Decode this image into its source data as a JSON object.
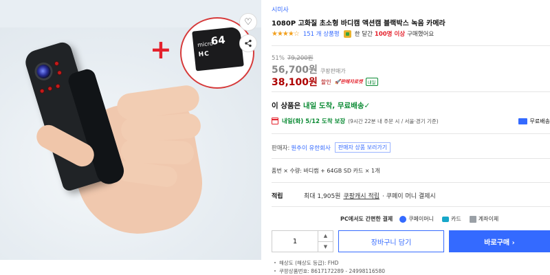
{
  "gallery": {
    "plus_sign": "+",
    "sd_card_capacity": "64",
    "sd_card_micro": "micro",
    "sd_card_class": "HC",
    "favorite_icon": "heart-outline-icon",
    "share_icon": "share-icon"
  },
  "product": {
    "brand": "시미사",
    "title": "1080P 고화질 초소형 바디캠 액션캠 블랙박스 녹음 카메라",
    "stars": "★★★★☆",
    "rating": 4,
    "review_count": "151 개 상품평",
    "sold_prefix": "한 달간",
    "sold_count": "100명 이상",
    "sold_suffix": "구매했어요"
  },
  "price": {
    "discount_rate": "51%",
    "original_price": "79,200원",
    "coupang_price": "56,700원",
    "coupang_label": "쿠팡판매가",
    "sale_price": "38,100원",
    "sale_label": "할인",
    "rocket_badge": "판매자로켓",
    "tomorrow_badge": "내일"
  },
  "delivery": {
    "headline_prefix": "이 상품은 ",
    "headline_highlight": "내일 도착, 무료배송",
    "headline_check": "✓",
    "date": "내일(화) 5/12 도착 보장",
    "date_note": "(9시간 22분 내 주문 시 / 서울·경기 기준)",
    "shipping_label": "무료배송"
  },
  "seller": {
    "label": "판매자:",
    "name": "원추이 유한회사",
    "more_button": "판매자 상품 보러가기"
  },
  "option": {
    "text": "품번 × 수량: 바디캠 + 64GB SD 카드 × 1개"
  },
  "reward": {
    "label": "적립",
    "max": "최대 1,905원",
    "link": "쿠팡캐시 적립",
    "tail": "· 쿠페이 머니 결제시"
  },
  "payment": {
    "headline": "PC에서도 간편한 결제",
    "options": [
      "쿠페이머니",
      "카드",
      "계좌이체"
    ]
  },
  "purchase": {
    "quantity": "1",
    "cart_button": "장바구니 담기",
    "buy_button": "바로구매 ›"
  },
  "specs": [
    "해상도 (해상도 등급): FHD",
    "쿠팡상품번호: 8617172289 - 24998116580"
  ],
  "colors": {
    "accent_blue": "#346aff",
    "sale_red": "#ae0000",
    "delivery_green": "#0a8a33",
    "star_orange": "#f29f1c"
  }
}
